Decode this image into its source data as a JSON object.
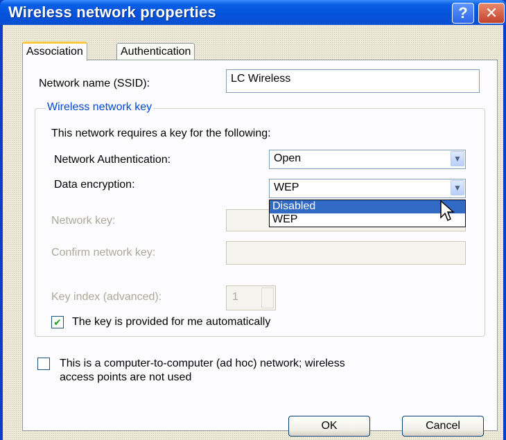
{
  "window": {
    "title": "Wireless network properties",
    "help_label": "?",
    "close_label": "✕"
  },
  "tabs": [
    {
      "label": "Association",
      "active": true
    },
    {
      "label": "Authentication",
      "active": false
    }
  ],
  "ssid": {
    "label": "Network name (SSID):",
    "value": "LC Wireless"
  },
  "key_group": {
    "legend": "Wireless network key",
    "description": "This network requires a key for the following:",
    "auth_label": "Network Authentication:",
    "auth_value": "Open",
    "encryption_label": "Data encryption:",
    "encryption_value": "WEP",
    "encryption_options": [
      "Disabled",
      "WEP"
    ],
    "encryption_highlighted": "Disabled",
    "network_key_label": "Network key:",
    "confirm_key_label": "Confirm network key:",
    "key_index_label": "Key index (advanced):",
    "key_index_value": "1",
    "auto_key_label": "The key is provided for me automatically",
    "auto_key_checked": true
  },
  "adhoc": {
    "label_line1": "This is a computer-to-computer (ad hoc) network; wireless",
    "label_line2": "access points are not used",
    "checked": false
  },
  "buttons": {
    "ok": "OK",
    "cancel": "Cancel"
  },
  "colors": {
    "title_bar": "#0553dd",
    "dialog_bg": "#ece9d8",
    "selection": "#316ac5",
    "group_legend": "#0046d5"
  }
}
